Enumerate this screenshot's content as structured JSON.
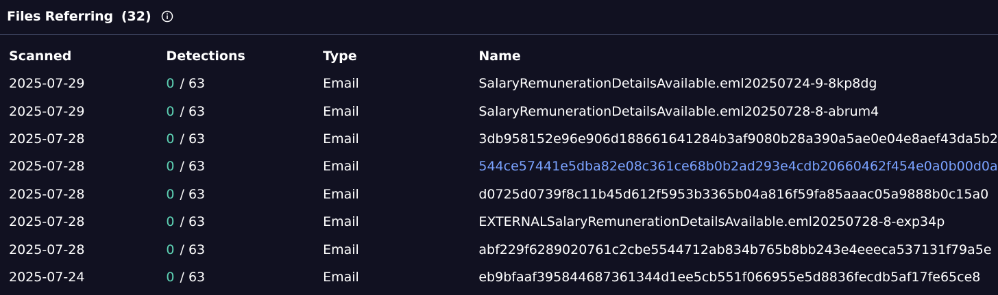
{
  "header": {
    "title": "Files Referring",
    "count": "(32)",
    "info_icon": "info-icon"
  },
  "table": {
    "columns": [
      "Scanned",
      "Detections",
      "Type",
      "Name"
    ],
    "rows": [
      {
        "scanned": "2025-07-29",
        "detections": "0",
        "total": "/ 63",
        "type": "Email",
        "name": "SalaryRemunerationDetailsAvailable.eml20250724-9-8kp8dg",
        "link": false
      },
      {
        "scanned": "2025-07-29",
        "detections": "0",
        "total": "/ 63",
        "type": "Email",
        "name": "SalaryRemunerationDetailsAvailable.eml20250728-8-abrum4",
        "link": false
      },
      {
        "scanned": "2025-07-28",
        "detections": "0",
        "total": "/ 63",
        "type": "Email",
        "name": "3db958152e96e906d188661641284b3af9080b28a390a5ae0e04e8aef43da5b2",
        "link": false
      },
      {
        "scanned": "2025-07-28",
        "detections": "0",
        "total": "/ 63",
        "type": "Email",
        "name": "544ce57441e5dba82e08c361ce68b0b2ad293e4cdb20660462f454e0a0b00d0a",
        "link": true
      },
      {
        "scanned": "2025-07-28",
        "detections": "0",
        "total": "/ 63",
        "type": "Email",
        "name": "d0725d0739f8c11b45d612f5953b3365b04a816f59fa85aaac05a9888b0c15a0",
        "link": false
      },
      {
        "scanned": "2025-07-28",
        "detections": "0",
        "total": "/ 63",
        "type": "Email",
        "name": "EXTERNALSalaryRemunerationDetailsAvailable.eml20250728-8-exp34p",
        "link": false
      },
      {
        "scanned": "2025-07-28",
        "detections": "0",
        "total": "/ 63",
        "type": "Email",
        "name": "abf229f6289020761c2cbe5544712ab834b765b8bb243e4eeeca537131f79a5e",
        "link": false
      },
      {
        "scanned": "2025-07-24",
        "detections": "0",
        "total": "/ 63",
        "type": "Email",
        "name": "eb9bfaaf395844687361344d1ee5cb551f066955e5d8836fecdb5af17fe65ce8",
        "link": false
      }
    ]
  },
  "colors": {
    "background": "#111121",
    "detection_clean": "#5ed3b5",
    "link": "#7aa2ff",
    "divider": "#3a3f5a"
  }
}
